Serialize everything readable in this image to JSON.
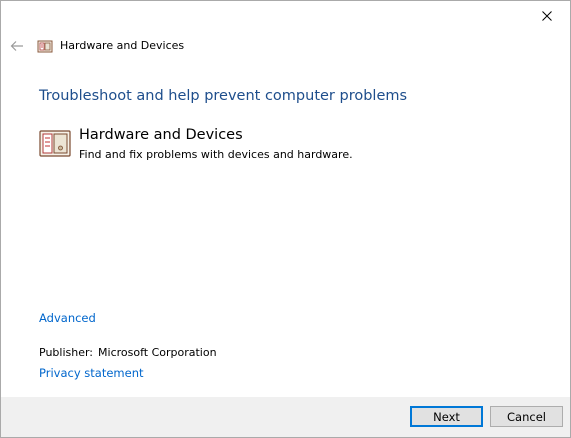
{
  "window": {
    "close_icon": "close-icon",
    "back_icon": "back-arrow-icon"
  },
  "titlebar": {
    "icon": "hardware-devices-icon",
    "title": "Hardware and Devices"
  },
  "main": {
    "heading": "Troubleshoot and help prevent computer problems",
    "item": {
      "icon": "hardware-devices-icon",
      "title": "Hardware and Devices",
      "description": "Find and fix problems with devices and hardware."
    },
    "advanced_link": "Advanced",
    "publisher_label": "Publisher:",
    "publisher_value": "Microsoft Corporation",
    "privacy_link": "Privacy statement"
  },
  "footer": {
    "next_label": "Next",
    "cancel_label": "Cancel"
  },
  "colors": {
    "heading": "#1e4e8c",
    "link": "#0066cc",
    "footer_bg": "#f0f0f0",
    "focus_border": "#0078d7"
  }
}
